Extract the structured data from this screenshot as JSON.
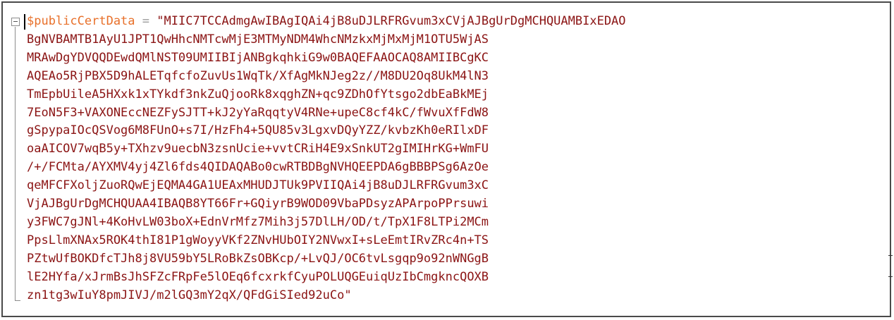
{
  "editor": {
    "variable": "$publicCertData",
    "operator": " = ",
    "quote_open": "\"",
    "quote_close": "\"",
    "lines": [
      "MIIC7TCCAdmgAwIBAgIQAi4jB8uDJLRFRGvum3xCVjAJBgUrDgMCHQUAMBIxEDAO",
      "BgNVBAMTB1AyU1JPT1QwHhcNMTcwMjE3MTMyNDM4WhcNMzkxMjMxMjM1OTU5WjAS",
      "MRAwDgYDVQQDEwdQMlNST09UMIIBIjANBgkqhkiG9w0BAQEFAAOCAQ8AMIIBCgKC",
      "AQEAo5RjPBX5D9hALETqfcfoZuvUs1WqTk/XfAgMkNJeg2z//M8DU2Oq8UkM4lN3",
      "TmEpbUileA5HXxk1xTYkdf3nkZuQjooRk8xqghZN+qc9ZDhOfYtsgo2dbEaBkMEj",
      "7EoN5F3+VAXONEccNEZFySJTT+kJ2yYaRqqtyV4RNe+upeC8cf4kC/fWvuXfFdW8",
      "gSpypaIOcQSVog6M8FUnO+s7I/HzFh4+5QU85v3LgxvDQyYZZ/kvbzKh0eRIlxDF",
      "oaAICOV7wqB5y+TXhzv9uecbN3zsnUcie+vvtCRiH4E9xSnkUT2gIMIHrKG+WmFU",
      "/+/FCMta/AYXMV4yj4Zl6fds4QIDAQABo0cwRTBDBgNVHQEEPDA6gBBBPSg6AzOe",
      "qeMFCFXoljZuoRQwEjEQMA4GA1UEAxMHUDJTUk9PVIIQAi4jB8uDJLRFRGvum3xC",
      "VjAJBgUrDgMCHQUAA4IBAQB8YT66Fr+GQiyrB9WOD09VbaPDsyzAPArpoPPrsuwi",
      "y3FWC7gJNl+4KoHvLW03boX+EdnVrMfz7Mih3j57DlLH/OD/t/TpX1F8LTPi2MCm",
      "PpsLlmXNAx5ROK4thI81P1gWoyyVKf2ZNvHUbOIY2NVwxI+sLeEmtIRvZRc4n+TS",
      "PZtwUfBOKDfcTJh8j8VU59bY5LRoBkZsOBKcp/+LvQJ/OC6tvLsgqp9o92nWNGgB",
      "lE2HYfa/xJrmBsJhSFZcFRpFe5lOEq6fcxrkfCyuPOLUQGEuiqUzIbCmgkncQOXB",
      "zn1tg3wIuY8pmJIVJ/m2lGQ3mY2qX/QFdGiSIed92uCo"
    ]
  }
}
